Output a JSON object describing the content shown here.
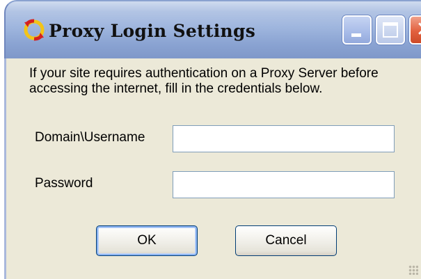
{
  "window": {
    "title": "Proxy Login Settings",
    "controls": {
      "minimize": "minimize",
      "maximize": "maximize",
      "close": "close"
    }
  },
  "description": "If your site requires authentication on a Proxy Server before accessing the internet, fill in the credentials below.",
  "form": {
    "username_label": "Domain\\Username",
    "username_value": "",
    "password_label": "Password",
    "password_value": ""
  },
  "buttons": {
    "ok_label": "OK",
    "cancel_label": "Cancel"
  },
  "icons": {
    "app": "proxy-app-icon",
    "close_glyph": "✕"
  },
  "colors": {
    "titlebar": "#9fb6de",
    "close_button": "#e2613f",
    "dialog_background": "#ece9d8",
    "button_border": "#003c74"
  }
}
